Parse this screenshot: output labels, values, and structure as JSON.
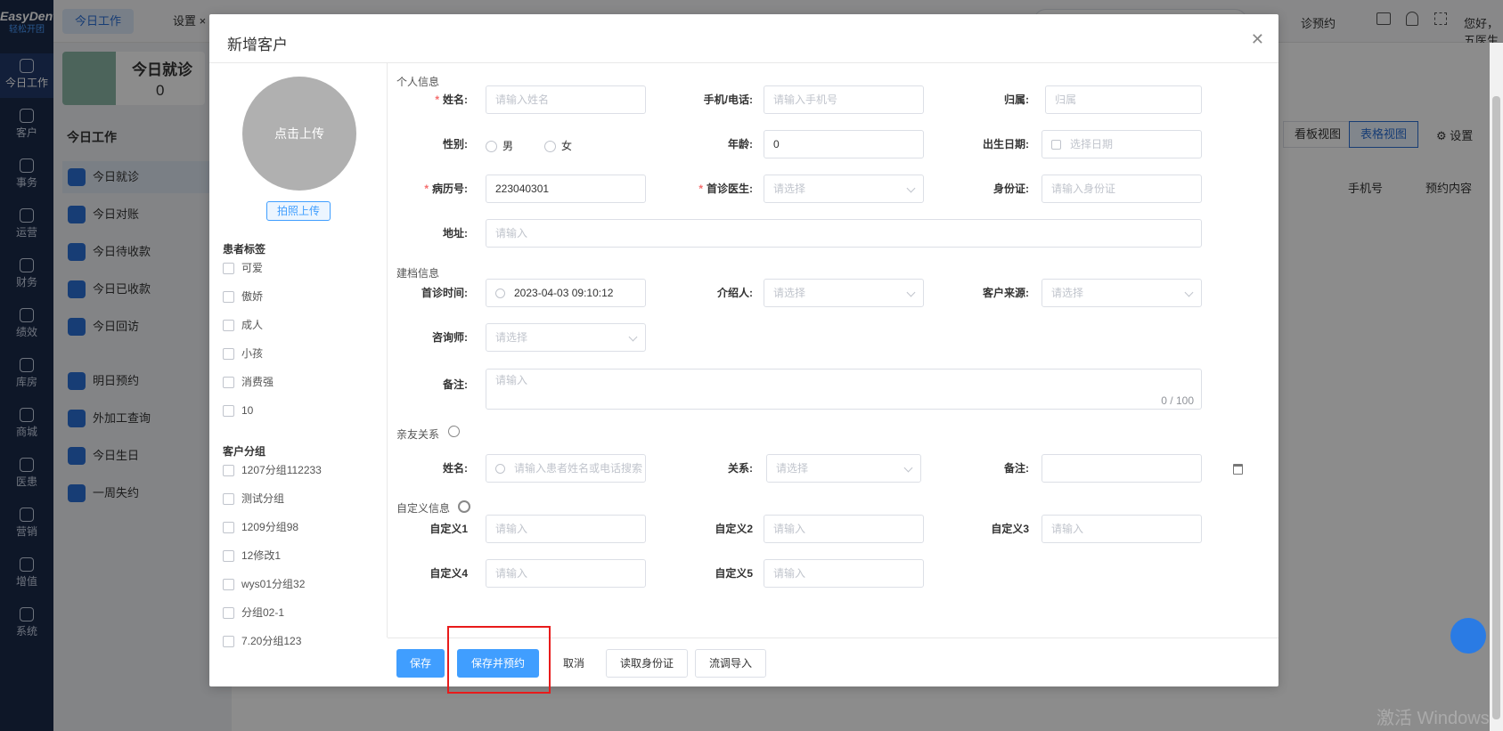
{
  "app": {
    "logo_text": "EasyDent",
    "logo_sub": "轻松开团"
  },
  "nav": [
    {
      "label": "今日工作",
      "icon": "home-icon",
      "active": true
    },
    {
      "label": "客户",
      "icon": "user-icon"
    },
    {
      "label": "事务",
      "icon": "document-icon"
    },
    {
      "label": "运营",
      "icon": "clock-icon"
    },
    {
      "label": "财务",
      "icon": "wallet-icon"
    },
    {
      "label": "绩效",
      "icon": "chart-icon"
    },
    {
      "label": "库房",
      "icon": "warehouse-icon"
    },
    {
      "label": "商城",
      "icon": "cart-icon"
    },
    {
      "label": "医患",
      "icon": "people-icon"
    },
    {
      "label": "营销",
      "icon": "megaphone-icon"
    },
    {
      "label": "增值",
      "icon": "gift-icon"
    },
    {
      "label": "系统",
      "icon": "gear-icon"
    }
  ],
  "topbar": {
    "tab_today": "今日工作",
    "tab_settings": "设置",
    "appointment": "诊预约",
    "greeting": "您好，五医生"
  },
  "left_panel": {
    "card_title": "今日就诊",
    "card_count": "0",
    "section": "今日工作",
    "items": [
      "今日就诊",
      "今日对账",
      "今日待收款",
      "今日已收款",
      "今日回访",
      "明日预约",
      "外加工查询",
      "今日生日",
      "一周失约"
    ]
  },
  "right_panel": {
    "board_view": "看板视图",
    "table_view": "表格视图",
    "settings": "设置",
    "col_phone": "手机号",
    "col_appt": "预约内容"
  },
  "modal": {
    "title": "新增客户",
    "upload_avatar": "点击上传",
    "photo_upload": "拍照上传",
    "patient_tags_title": "患者标签",
    "patient_tags": [
      "可爱",
      "傲娇",
      "成人",
      "小孩",
      "消费强",
      "10"
    ],
    "customer_groups_title": "客户分组",
    "customer_groups": [
      "1207分组112233",
      "测试分组",
      "1209分组98",
      "12修改1",
      "wys01分组32",
      "分组02-1",
      "7.20分组123"
    ],
    "personal": {
      "section": "个人信息",
      "name_label": "姓名:",
      "name_ph": "请输入姓名",
      "phone_label": "手机/电话:",
      "phone_ph": "请输入手机号",
      "belong_label": "归属:",
      "belong_ph": "归属",
      "gender_label": "性别:",
      "male": "男",
      "female": "女",
      "age_label": "年龄:",
      "age_val": "0",
      "birth_label": "出生日期:",
      "birth_ph": "选择日期",
      "record_label": "病历号:",
      "record_val": "223040301",
      "doctor_label": "首诊医生:",
      "doctor_ph": "请选择",
      "id_label": "身份证:",
      "id_ph": "请输入身份证",
      "address_label": "地址:",
      "address_ph": "请输入"
    },
    "archive": {
      "section": "建档信息",
      "first_time_label": "首诊时间:",
      "first_time_val": "2023-04-03 09:10:12",
      "referrer_label": "介绍人:",
      "referrer_ph": "请选择",
      "source_label": "客户来源:",
      "source_ph": "请选择",
      "consultant_label": "咨询师:",
      "consultant_ph": "请选择",
      "remark_label": "备注:",
      "remark_ph": "请输入",
      "remark_count": "0 / 100"
    },
    "relatives": {
      "section": "亲友关系",
      "name_label": "姓名:",
      "name_ph": "请输入患者姓名或电话搜索",
      "relation_label": "关系:",
      "relation_ph": "请选择",
      "note_label": "备注:"
    },
    "custom": {
      "section": "自定义信息",
      "c1": "自定义1",
      "c2": "自定义2",
      "c3": "自定义3",
      "c4": "自定义4",
      "c5": "自定义5",
      "ph": "请输入"
    },
    "buttons": {
      "save": "保存",
      "save_appt": "保存并预约",
      "cancel": "取消",
      "read_id": "读取身份证",
      "import": "流调导入"
    }
  },
  "watermark": "激活 Windows"
}
